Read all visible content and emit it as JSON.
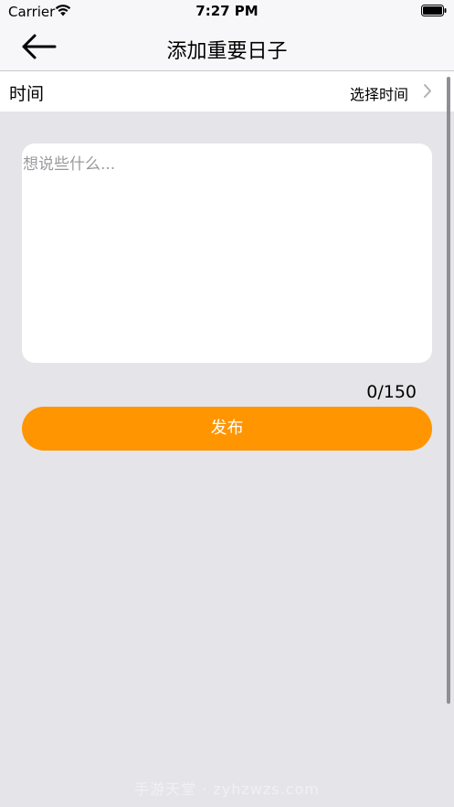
{
  "status_bar": {
    "carrier": "Carrier",
    "time": "7:27 PM"
  },
  "nav": {
    "title": "添加重要日子",
    "back_icon": "arrow-left-icon"
  },
  "time_row": {
    "label": "时间",
    "value": "选择时间",
    "chevron_icon": "chevron-right-icon"
  },
  "note": {
    "placeholder": "想说些什么...",
    "value": ""
  },
  "counter": "0/150",
  "publish_button": {
    "label": "发布",
    "color": "#ff9500"
  },
  "watermark": "手游天堂 · zyhzwzs.com",
  "colors": {
    "background": "#e5e4e9",
    "accent": "#ff9500"
  }
}
